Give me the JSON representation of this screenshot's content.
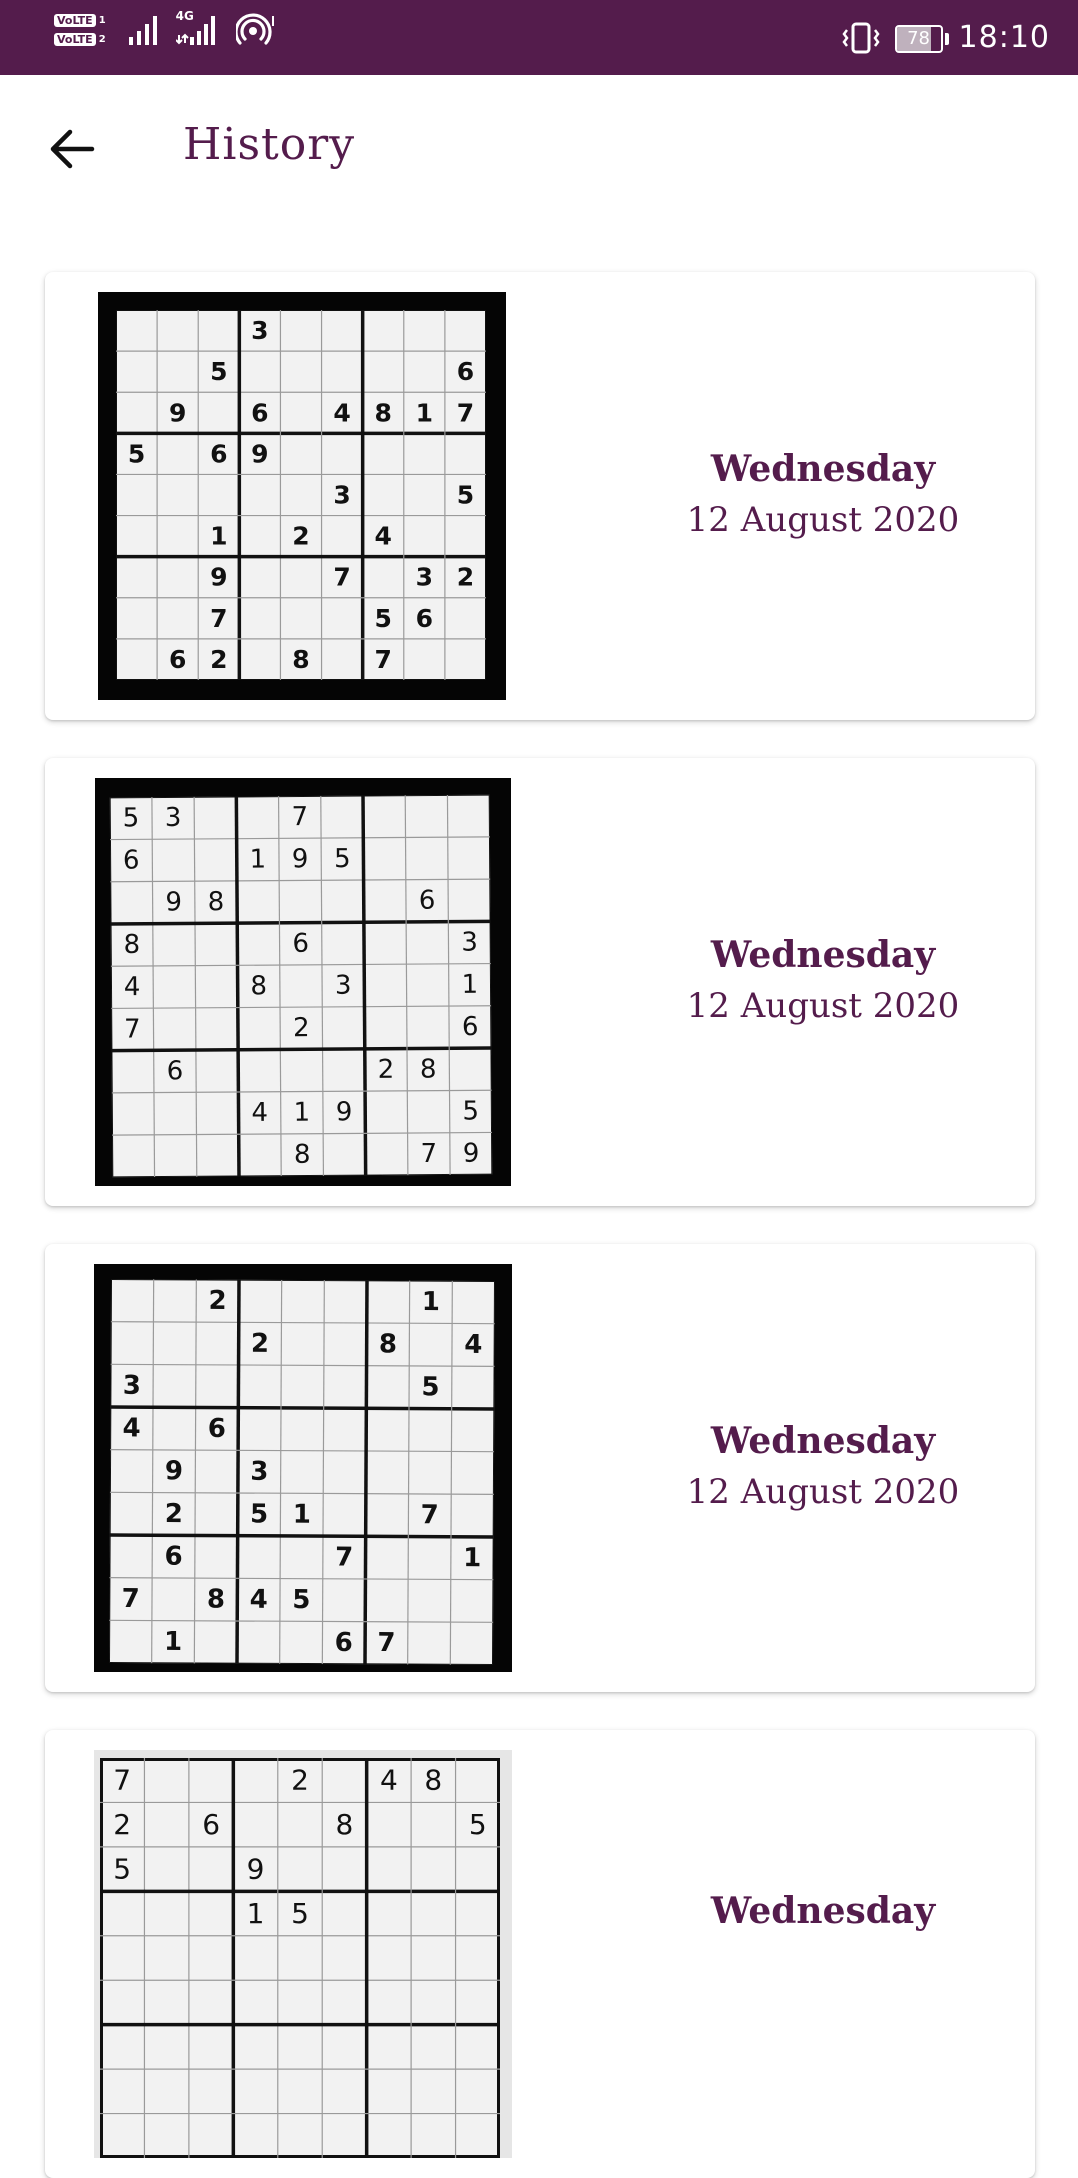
{
  "status_bar": {
    "volte1": "VoLTE",
    "slot1": "1",
    "volte2": "VoLTE",
    "slot2": "2",
    "network": "4G",
    "battery_level": "78",
    "battery_fraction": 0.78,
    "time": "18:10",
    "icons": [
      "signal-icon",
      "signal-4g-icon",
      "hotspot-icon",
      "vibrate-icon",
      "battery-icon"
    ]
  },
  "app_bar": {
    "back_icon": "arrow-back-icon",
    "title": "History"
  },
  "colors": {
    "primary": "#541c4c",
    "background": "#ffffff"
  },
  "history": [
    {
      "weekday": "Wednesday",
      "date": "12 August 2020",
      "puzzle": [
        [
          0,
          0,
          0,
          3,
          0,
          0,
          0,
          0,
          0
        ],
        [
          0,
          0,
          5,
          0,
          0,
          0,
          0,
          0,
          6
        ],
        [
          0,
          9,
          0,
          6,
          0,
          4,
          8,
          1,
          7
        ],
        [
          5,
          0,
          6,
          9,
          0,
          0,
          0,
          0,
          0
        ],
        [
          0,
          0,
          0,
          0,
          0,
          3,
          0,
          0,
          5
        ],
        [
          0,
          0,
          1,
          0,
          2,
          0,
          4,
          0,
          0
        ],
        [
          0,
          0,
          9,
          0,
          0,
          7,
          0,
          3,
          2
        ],
        [
          0,
          0,
          7,
          0,
          0,
          0,
          5,
          6,
          0
        ],
        [
          0,
          6,
          2,
          0,
          8,
          0,
          7,
          0,
          0
        ]
      ]
    },
    {
      "weekday": "Wednesday",
      "date": "12 August 2020",
      "puzzle": [
        [
          5,
          3,
          0,
          0,
          7,
          0,
          0,
          0,
          0
        ],
        [
          6,
          0,
          0,
          1,
          9,
          5,
          0,
          0,
          0
        ],
        [
          0,
          9,
          8,
          0,
          0,
          0,
          0,
          6,
          0
        ],
        [
          8,
          0,
          0,
          0,
          6,
          0,
          0,
          0,
          3
        ],
        [
          4,
          0,
          0,
          8,
          0,
          3,
          0,
          0,
          1
        ],
        [
          7,
          0,
          0,
          0,
          2,
          0,
          0,
          0,
          6
        ],
        [
          0,
          6,
          0,
          0,
          0,
          0,
          2,
          8,
          0
        ],
        [
          0,
          0,
          0,
          4,
          1,
          9,
          0,
          0,
          5
        ],
        [
          0,
          0,
          0,
          0,
          8,
          0,
          0,
          7,
          9
        ]
      ]
    },
    {
      "weekday": "Wednesday",
      "date": "12 August 2020",
      "puzzle": [
        [
          0,
          0,
          2,
          0,
          0,
          0,
          0,
          1,
          0
        ],
        [
          0,
          0,
          0,
          2,
          0,
          0,
          8,
          0,
          4
        ],
        [
          3,
          0,
          0,
          0,
          0,
          0,
          0,
          5,
          0
        ],
        [
          4,
          0,
          6,
          0,
          0,
          0,
          0,
          0,
          0
        ],
        [
          0,
          9,
          0,
          3,
          0,
          0,
          0,
          0,
          0
        ],
        [
          0,
          2,
          0,
          5,
          1,
          0,
          0,
          7,
          0
        ],
        [
          0,
          6,
          0,
          0,
          0,
          7,
          0,
          0,
          1
        ],
        [
          7,
          0,
          8,
          4,
          5,
          0,
          0,
          0,
          0
        ],
        [
          0,
          1,
          0,
          0,
          0,
          6,
          7,
          0,
          0
        ]
      ]
    },
    {
      "weekday": "Wednesday",
      "date": "",
      "puzzle": [
        [
          7,
          0,
          0,
          0,
          2,
          0,
          4,
          8,
          0
        ],
        [
          2,
          0,
          6,
          0,
          0,
          8,
          0,
          0,
          5
        ],
        [
          5,
          0,
          0,
          9,
          0,
          0,
          0,
          0,
          0
        ],
        [
          0,
          0,
          0,
          1,
          5,
          0,
          0,
          0,
          0
        ],
        [
          0,
          0,
          0,
          0,
          0,
          0,
          0,
          0,
          0
        ],
        [
          0,
          0,
          0,
          0,
          0,
          0,
          0,
          0,
          0
        ],
        [
          0,
          0,
          0,
          0,
          0,
          0,
          0,
          0,
          0
        ],
        [
          0,
          0,
          0,
          0,
          0,
          0,
          0,
          0,
          0
        ],
        [
          0,
          0,
          0,
          0,
          0,
          0,
          0,
          0,
          0
        ]
      ]
    }
  ]
}
